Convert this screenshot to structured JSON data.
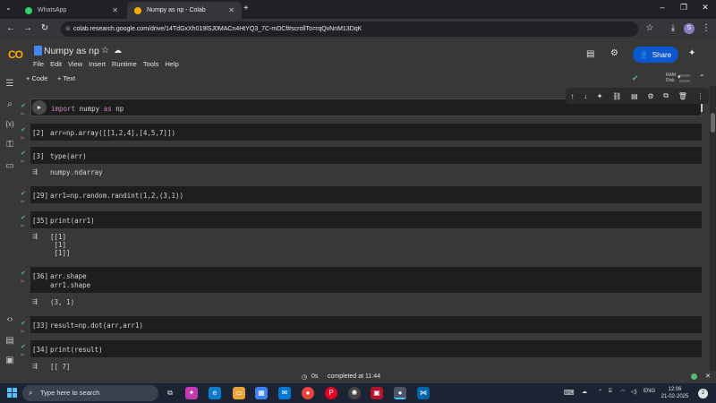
{
  "browser": {
    "tabs": [
      {
        "label": "WhatsApp",
        "icon": "whatsapp-icon",
        "color": "#25d366"
      },
      {
        "label": "Numpy as np - Colab",
        "icon": "colab-icon",
        "color": "#f9ab00"
      }
    ],
    "url": "colab.research.google.com/drive/14TdGxXh019lSJ0MACn4HtYQ3_7C-mDCf#scrollTo=rqQvNnM13DqK",
    "profile_initial": "S"
  },
  "colab": {
    "logo": "CO",
    "title": "Numpy as np",
    "menu": [
      "File",
      "Edit",
      "View",
      "Insert",
      "Runtime",
      "Tools",
      "Help"
    ],
    "share_label": "Share",
    "add_code": "+ Code",
    "add_text": "+ Text",
    "ram_label": "RAM",
    "disk_label": "Disk",
    "accent": "#0b57d0"
  },
  "cells": [
    {
      "num": "",
      "code_parts": [
        {
          "t": "import",
          "c": "kw"
        },
        {
          "t": " numpy "
        },
        {
          "t": "as",
          "c": "kw"
        },
        {
          "t": " np"
        }
      ],
      "check": "✔",
      "time": "0s",
      "output": ""
    },
    {
      "num": "[2]",
      "code": "arr=np.array([[1,2,4],[4,5,7]])",
      "check": "✔",
      "time": "0s",
      "output": ""
    },
    {
      "num": "[3]",
      "code": "type(arr)",
      "check": "✔",
      "time": "0s",
      "output": "numpy.ndarray"
    },
    {
      "num": "[29]",
      "code": "arr1=np.random.randint(1,2,(3,1))",
      "check": "✔",
      "time": "0s",
      "output": ""
    },
    {
      "num": "[35]",
      "code": "print(arr1)",
      "check": "✔",
      "time": "0s",
      "output": "[[1]\n [1]\n [1]]"
    },
    {
      "num": "[36]",
      "code": "arr.shape\narr1.shape",
      "check": "✔",
      "time": "0s",
      "output": "(3, 1)"
    },
    {
      "num": "[33]",
      "code": "result=np.dot(arr,arr1)",
      "check": "✔",
      "time": "0s",
      "output": ""
    },
    {
      "num": "[34]",
      "code": "print(result)",
      "check": "✔",
      "time": "0s",
      "output": "[[ 7]"
    }
  ],
  "status": {
    "time": "0s",
    "text": "completed at 11:44"
  },
  "taskbar": {
    "search_placeholder": "Type here to search",
    "language": "ENG",
    "time": "12:06",
    "date": "21-02-2025",
    "notifications": "2"
  }
}
